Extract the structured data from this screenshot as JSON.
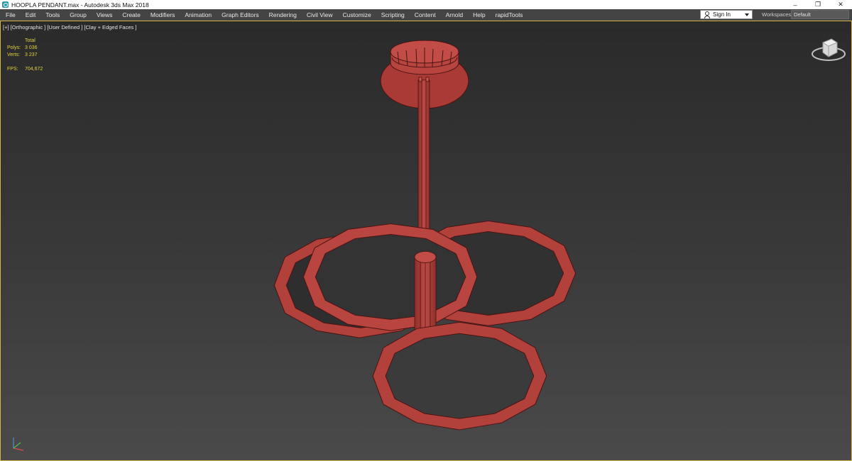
{
  "window": {
    "title": "HOOPLA PENDANT.max - Autodesk 3ds Max 2018",
    "minimize_label": "–",
    "restore_label": "❐",
    "close_label": "✕"
  },
  "menu": {
    "items": [
      "File",
      "Edit",
      "Tools",
      "Group",
      "Views",
      "Create",
      "Modifiers",
      "Animation",
      "Graph Editors",
      "Rendering",
      "Civil View",
      "Customize",
      "Scripting",
      "Content",
      "Arnold",
      "Help",
      "rapidTools"
    ],
    "signin_label": "Sign In",
    "workspaces_label": "Workspaces:",
    "workspace_value": "Default"
  },
  "viewport": {
    "label": "[+] [Orthographic ] [User Defined ] [Clay + Edged Faces ]",
    "stats": {
      "total_label": "Total",
      "polys_label": "Polys:",
      "polys_value": "3 036",
      "verts_label": "Verts:",
      "verts_value": "3 237",
      "fps_label": "FPS:",
      "fps_value": "704,672"
    }
  },
  "colors": {
    "mesh_fill": "#b2413c",
    "mesh_edge": "#4a1412",
    "accent_border": "#d9b44a",
    "stats_text": "#e3d43a"
  },
  "icons": [
    "app-icon",
    "user-icon",
    "chevron-down-icon",
    "view-cube-icon",
    "axis-gizmo-icon"
  ]
}
